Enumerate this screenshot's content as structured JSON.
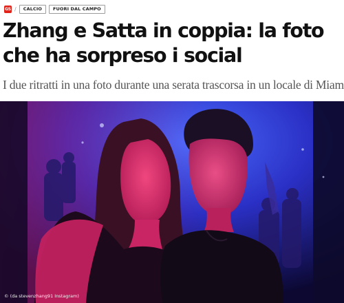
{
  "breadcrumb": {
    "logo_text": "GS",
    "separator": "/",
    "tags": [
      "CALCIO",
      "FUORI DAL CAMPO"
    ]
  },
  "article": {
    "headline": "Zhang e Satta in coppia: la foto che ha sorpreso i social",
    "subtitle": "I due ritratti in una foto durante una serata trascorsa in un locale di Miami"
  },
  "photo": {
    "credit": "© (da stevenzhang91 Instagram)"
  },
  "colors": {
    "brand": "#e2231a",
    "headline": "#111111",
    "subtitle": "#555555"
  }
}
